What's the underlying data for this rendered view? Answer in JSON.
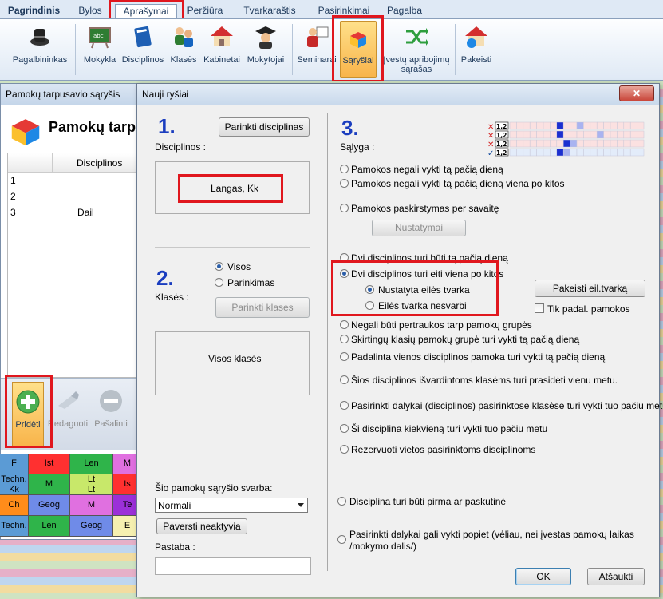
{
  "menu_tabs": [
    "Pagrindinis",
    "Bylos",
    "Aprašymai",
    "Peržiūra",
    "Tvarkaraštis",
    "Pasirinkimai",
    "Pagalba"
  ],
  "ribbon": {
    "helpers": "Pagalbininkas",
    "teachers": "Mokykla",
    "subjects": "Disciplinos",
    "classes": "Klasės",
    "rooms": "Kabinetai",
    "tutors": "Mokytojai",
    "seminars": "Seminarai",
    "relations": "Sąryšiai",
    "restrictions_line1": "Įvestų apribojimų",
    "restrictions_line2": "sąrašas",
    "changes": "Pakeisti"
  },
  "bg_window": {
    "title": "Pamokų tarpusavio sąryšis",
    "heading": "Pamokų tarpu",
    "column_header": "Disciplinos",
    "rows": [
      {
        "n": "1",
        "v": ""
      },
      {
        "n": "2",
        "v": ""
      },
      {
        "n": "3",
        "v": "Dail"
      }
    ],
    "buttons": {
      "add": "Pridėti",
      "edit": "Redaguoti",
      "remove": "Pašalinti"
    }
  },
  "timetable": [
    [
      "F",
      "Ist",
      "Len",
      "M"
    ],
    [
      "Techn.\nKk",
      "M",
      "Lt\nLt",
      "Is"
    ],
    [
      "Ch",
      "Geog",
      "M",
      "Te"
    ],
    [
      "Techn.",
      "Len",
      "Geog",
      "E"
    ]
  ],
  "dialog": {
    "title": "Nauji ryšiai",
    "close": "✕",
    "section1": {
      "number": "1.",
      "label": "Disciplinos :",
      "pick_button": "Parinkti disciplinas",
      "selected": "Langas, Kk"
    },
    "section2": {
      "number": "2.",
      "label": "Klasės :",
      "opt_all": "Visos",
      "opt_pick": "Parinkimas",
      "pick_button": "Parinkti klases",
      "selected": "Visos klasės"
    },
    "section3": {
      "number": "3.",
      "label": "Sąlyga :",
      "conditions": [
        "Pamokos negali vykti tą pačią dieną",
        "Pamokos negali vykti tą pačią dieną viena po kitos",
        "Pamokos paskirstymas per savaitę"
      ],
      "settings_button": "Nustatymai",
      "cond_same_day": "Dvi disciplinos turi būti tą pačią dieną",
      "cond_sequence": "Dvi disciplinos turi eiti viena po kitos",
      "order_fixed": "Nustatyta eilės tvarka",
      "order_any": "Eilės tvarka nesvarbi",
      "change_order_button": "Pakeisti eil.tvarką",
      "only_split": "Tik padal. pamokos",
      "more_conditions": [
        "Negali būti pertraukos tarp pamokų grupės",
        "Skirtingų klasių pamokų grupė turi vykti tą pačią dieną",
        "Padalinta vienos disciplinos pamoka turi vykti tą pačią dieną",
        "Šios disciplinos išvardintoms klasėms turi prasidėti vienu metu.",
        "Pasirinkti dalykai (disciplinos) pasirinktose klasėse turi vykti tuo pačiu metu.",
        "Ši disciplina kiekvieną turi vykti tuo pačiu metu",
        "Rezervuoti vietos pasirinktoms disciplinoms"
      ],
      "first_or_last": "Disciplina turi būti pirma ar paskutinė",
      "after_line1": "Pasirinkti dalykai gali vykti popiet (vėliau, nei įvestas pamokų laikas",
      "after_line2": "/mokymo dalis/)"
    },
    "importance_label": "Šio pamokų sąryšio svarba:",
    "importance_value": "Normali",
    "make_inactive_button": "Paversti neaktyvia",
    "note_label": "Pastaba :",
    "ok": "OK",
    "cancel": "Atšaukti"
  },
  "preview_badges": [
    "1,2",
    "1,2",
    "1,2",
    "1,2"
  ],
  "colors": {
    "accent_red": "#e0171e",
    "number_blue": "#1a3dbf",
    "selection": "#2b5ea8"
  }
}
